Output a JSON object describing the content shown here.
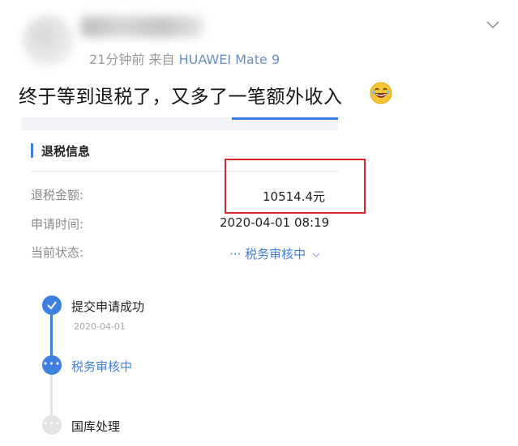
{
  "post": {
    "time_ago": "21分钟前",
    "source_prefix": "来自",
    "device": "HUAWEI Mate 9",
    "title": "终于等到退税了，又多了一笔额外收入"
  },
  "section": {
    "title": "退税信息"
  },
  "rows": [
    {
      "label": "退税金额:",
      "value": "10514.4元"
    },
    {
      "label": "申请时间:",
      "value": "2020-04-01 08:19"
    },
    {
      "label": "当前状态:",
      "value": "税务审核中"
    }
  ],
  "status_prefix": "···",
  "timeline": [
    {
      "label": "提交申请成功",
      "date": "2020-04-01",
      "state": "done"
    },
    {
      "label": "税务审核中",
      "state": "active"
    },
    {
      "label": "国库处理",
      "state": "pending"
    }
  ],
  "colors": {
    "accent": "#3f7fe0",
    "highlight_box": "#d9262c",
    "label_gray": "#8a8a8a"
  },
  "icons": {
    "top_right": "chevron-down-icon",
    "emoji": "grinning-face-icon",
    "done": "checkmark-icon",
    "active": "ellipsis-icon",
    "pending": "ellipsis-icon"
  }
}
